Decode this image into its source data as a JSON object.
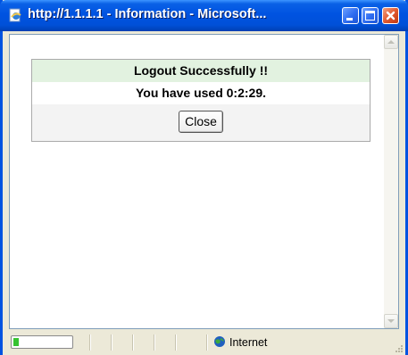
{
  "window": {
    "title": "http://1.1.1.1 - Information - Microsoft...",
    "title_icon": "ie-page-icon",
    "buttons": [
      "minimize",
      "maximize",
      "close"
    ]
  },
  "dialog": {
    "heading": "Logout Successfully !!",
    "message": "You have used 0:2:29.",
    "close_label": "Close"
  },
  "statusbar": {
    "zone": "Internet",
    "zone_icon": "globe-icon"
  },
  "colors": {
    "titlebar": "#0053e1",
    "heading_bg": "#e2f2e0",
    "button_row_bg": "#f3f3f3",
    "progress_fill": "#37c331"
  }
}
